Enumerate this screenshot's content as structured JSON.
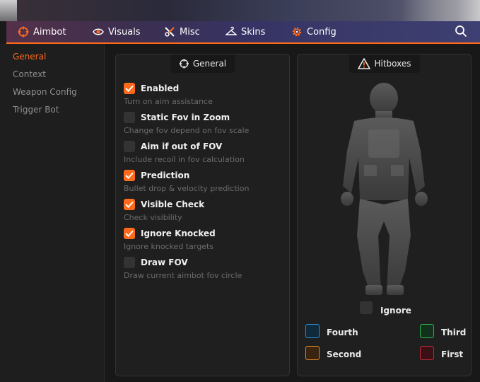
{
  "nav": {
    "tabs": [
      {
        "label": "Aimbot",
        "icon": "crosshair-icon",
        "active": true
      },
      {
        "label": "Visuals",
        "icon": "eye-icon",
        "active": false
      },
      {
        "label": "Misc",
        "icon": "tools-icon",
        "active": false
      },
      {
        "label": "Skins",
        "icon": "hanger-icon",
        "active": false
      },
      {
        "label": "Config",
        "icon": "gear-icon",
        "active": false
      }
    ],
    "search_icon": "search-icon",
    "accent": "#ff6a1a"
  },
  "sidebar": {
    "items": [
      {
        "label": "General",
        "active": true
      },
      {
        "label": "Context",
        "active": false
      },
      {
        "label": "Weapon Config",
        "active": false
      },
      {
        "label": "Trigger Bot",
        "active": false
      }
    ]
  },
  "general_panel": {
    "title": "General",
    "options": [
      {
        "label": "Enabled",
        "desc": "Turn on aim assistance",
        "checked": true
      },
      {
        "label": "Static Fov in Zoom",
        "desc": "Change fov depend on fov scale",
        "checked": false
      },
      {
        "label": "Aim if out of FOV",
        "desc": "Include recoil in fov calculation",
        "checked": false
      },
      {
        "label": "Prediction",
        "desc": "Bullet drop & velocity prediction",
        "checked": true
      },
      {
        "label": "Visible Check",
        "desc": "Check visibility",
        "checked": true
      },
      {
        "label": "Ignore Knocked",
        "desc": "Ignore knocked targets",
        "checked": true
      },
      {
        "label": "Draw FOV",
        "desc": "Draw current aimbot fov circle",
        "checked": false
      }
    ]
  },
  "hitboxes_panel": {
    "title": "Hitboxes",
    "ignore": {
      "label": "Ignore",
      "checked": false
    },
    "levels": [
      {
        "label": "Fourth",
        "color": "#2f8fcf"
      },
      {
        "label": "Third",
        "color": "#2eb350"
      },
      {
        "label": "Second",
        "color": "#e0882a"
      },
      {
        "label": "First",
        "color": "#c0283a"
      }
    ]
  }
}
